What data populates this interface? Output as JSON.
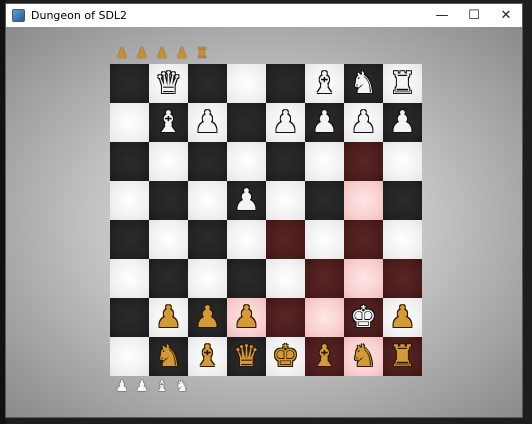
{
  "window": {
    "title": "Dungeon of SDL2"
  },
  "controls": {
    "minimize": "—",
    "maximize": "☐",
    "close": "✕"
  },
  "glyphs": {
    "K": "♚",
    "Q": "♛",
    "R": "♜",
    "B": "♝",
    "N": "♞",
    "P": "♟"
  },
  "captured_top": [
    {
      "piece": "P",
      "side": "gold"
    },
    {
      "piece": "P",
      "side": "gold"
    },
    {
      "piece": "P",
      "side": "gold"
    },
    {
      "piece": "P",
      "side": "gold"
    },
    {
      "piece": "R",
      "side": "gold"
    }
  ],
  "captured_bottom": [
    {
      "piece": "P",
      "side": "white"
    },
    {
      "piece": "P",
      "side": "white"
    },
    {
      "piece": "B",
      "side": "white"
    },
    {
      "piece": "N",
      "side": "white"
    }
  ],
  "board": [
    [
      "",
      "wQ",
      "",
      "",
      "",
      "wB",
      "wN",
      "wR"
    ],
    [
      "",
      "wB",
      "wP",
      "",
      "wP",
      "wP",
      "wP",
      "wP"
    ],
    [
      "",
      "",
      "",
      "",
      "",
      "",
      "",
      ""
    ],
    [
      "",
      "",
      "",
      "wP",
      "",
      "",
      "",
      ""
    ],
    [
      "",
      "",
      "",
      "",
      "",
      "",
      "",
      ""
    ],
    [
      "",
      "",
      "",
      "",
      "",
      "",
      "",
      ""
    ],
    [
      "",
      "gP",
      "gP",
      "gP",
      "",
      "",
      "wK",
      "gP"
    ],
    [
      "",
      "gN",
      "gB",
      "gQ",
      "gK",
      "gB",
      "gN",
      "gR"
    ]
  ],
  "highlights": [
    [
      2,
      6
    ],
    [
      3,
      6
    ],
    [
      4,
      4
    ],
    [
      4,
      6
    ],
    [
      5,
      5
    ],
    [
      5,
      6
    ],
    [
      5,
      7
    ],
    [
      6,
      3
    ],
    [
      6,
      4
    ],
    [
      6,
      5
    ],
    [
      6,
      6
    ],
    [
      7,
      5
    ],
    [
      7,
      6
    ],
    [
      7,
      7
    ]
  ]
}
